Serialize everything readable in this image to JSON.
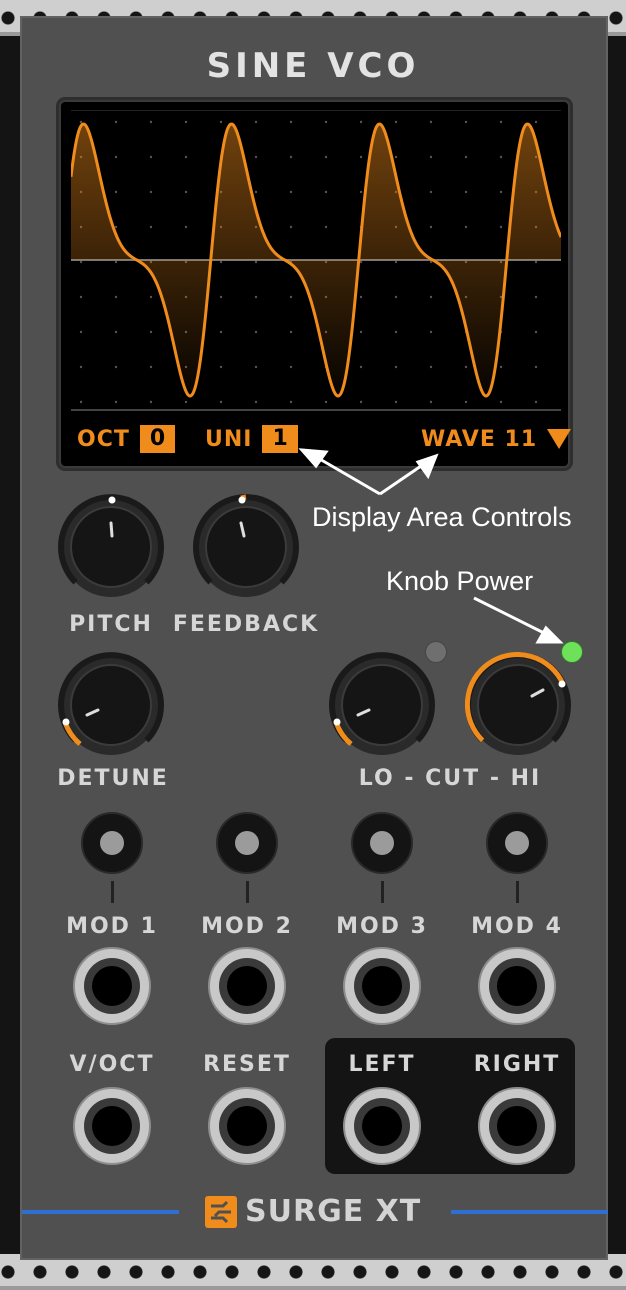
{
  "module": {
    "title": "SINE VCO",
    "brand": "SURGE XT",
    "accent_color": "#f08c1c",
    "led_on_color": "#6ee05a",
    "led_off_color": "#6f6f6f"
  },
  "display": {
    "oct_label": "OCT",
    "oct_value": "0",
    "uni_label": "UNI",
    "uni_value": "1",
    "wave_label": "WAVE 11"
  },
  "knobs": {
    "pitch": {
      "label": "PITCH"
    },
    "feedback": {
      "label": "FEEDBACK"
    },
    "detune": {
      "label": "DETUNE"
    },
    "lo_cut_hi": {
      "label": "LO - CUT - HI"
    }
  },
  "mod_jacks": [
    "MOD 1",
    "MOD 2",
    "MOD 3",
    "MOD 4"
  ],
  "inputs": {
    "voct": "V/OCT",
    "reset": "RESET"
  },
  "outputs": {
    "left": "LEFT",
    "right": "RIGHT"
  },
  "annotations": {
    "display_area": "Display Area Controls",
    "knob_power": "Knob Power"
  }
}
